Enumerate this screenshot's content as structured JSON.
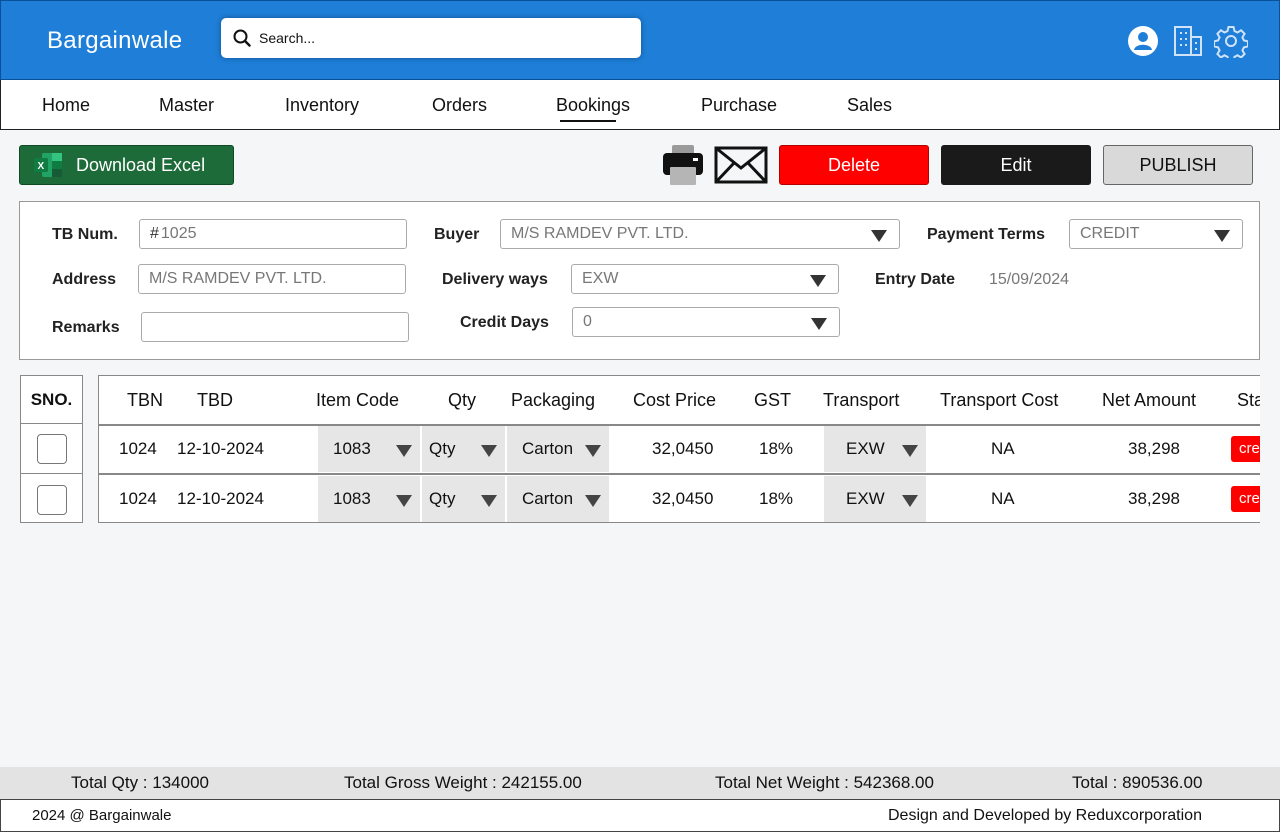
{
  "app": {
    "brand": "Bargainwale"
  },
  "search": {
    "placeholder": "Search..."
  },
  "header_icons": [
    "user-icon",
    "building-icon",
    "gear-icon"
  ],
  "nav": {
    "items": [
      "Home",
      "Master",
      "Inventory",
      "Orders",
      "Bookings",
      "Purchase",
      "Sales"
    ],
    "active": "Bookings"
  },
  "toolbar": {
    "download_excel": "Download Excel",
    "delete": "Delete",
    "edit": "Edit",
    "publish": "PUBLISH",
    "icons": [
      "excel-icon",
      "printer-icon",
      "mail-icon"
    ]
  },
  "form": {
    "tb_num": {
      "label": "TB Num.",
      "value": "1025"
    },
    "buyer": {
      "label": "Buyer",
      "value": "M/S RAMDEV PVT. LTD."
    },
    "payment_terms": {
      "label": "Payment Terms",
      "value": "CREDIT"
    },
    "address": {
      "label": "Address",
      "value": "M/S RAMDEV PVT. LTD."
    },
    "delivery_ways": {
      "label": "Delivery ways",
      "value": "EXW"
    },
    "entry_date": {
      "label": "Entry Date",
      "value": "15/09/2024"
    },
    "remarks": {
      "label": "Remarks",
      "value": ""
    },
    "credit_days": {
      "label": "Credit Days",
      "value": "0"
    }
  },
  "table": {
    "sno_header": "SNO.",
    "columns": [
      "TBN",
      "TBD",
      "Item Code",
      "Qty",
      "Packaging",
      "Cost Price",
      "GST",
      "Transport",
      "Transport Cost",
      "Net Amount",
      "Status"
    ],
    "rows": [
      {
        "tbn": "1024",
        "tbd": "12-10-2024",
        "item_code": "1083",
        "qty": "Qty",
        "packaging": "Carton",
        "cost_price": "32,0450",
        "gst": "18%",
        "transport": "EXW",
        "transport_cost": "NA",
        "net_amount": "38,298",
        "status": "created"
      },
      {
        "tbn": "1024",
        "tbd": "12-10-2024",
        "item_code": "1083",
        "qty": "Qty",
        "packaging": "Carton",
        "cost_price": "32,0450",
        "gst": "18%",
        "transport": "EXW",
        "transport_cost": "NA",
        "net_amount": "38,298",
        "status": "created"
      }
    ]
  },
  "totals": {
    "qty": "Total Qty : 134000",
    "gross_weight": "Total Gross Weight : 242155.00",
    "net_weight": "Total Net Weight : 542368.00",
    "total": "Total : 890536.00"
  },
  "footer": {
    "copyright": "2024 @ Bargainwale",
    "credit": "Design and Developed by Reduxcorporation"
  },
  "colors": {
    "header_blue": "#1e7ed8",
    "excel_green": "#1d6b38",
    "delete_red": "#ff0000",
    "edit_black": "#1a1a1a",
    "status_red": "#ff0000"
  }
}
